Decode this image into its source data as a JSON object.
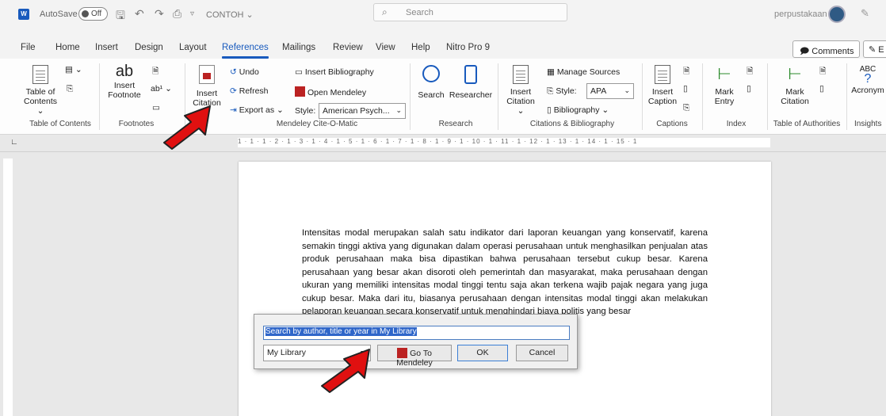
{
  "titlebar": {
    "autosave_label": "AutoSave",
    "autosave_state": "Off",
    "document_name": "CONTOH",
    "search_placeholder": "Search",
    "user_name": "perpustakaan"
  },
  "tabs": [
    "File",
    "Home",
    "Insert",
    "Design",
    "Layout",
    "References",
    "Mailings",
    "Review",
    "View",
    "Help",
    "Nitro Pro 9"
  ],
  "active_tab": "References",
  "header_buttons": {
    "comments": "Comments",
    "editing": "E"
  },
  "ribbon": {
    "toc": {
      "label1": "Table of",
      "label2": "Contents",
      "group": "Table of Contents"
    },
    "footnotes": {
      "ab": "ab",
      "insert1": "Insert",
      "insert2": "Footnote",
      "group": "Footnotes"
    },
    "insert_citation": {
      "line1": "Insert",
      "line2": "Citation"
    },
    "mendeley": {
      "undo": "Undo",
      "refresh": "Refresh",
      "export": "Export as",
      "insert_bibliography": "Insert Bibliography",
      "open_mendeley": "Open Mendeley",
      "style_label": "Style:",
      "style_value": "American Psych...",
      "group": "Mendeley Cite-O-Matic"
    },
    "research": {
      "search": "Search",
      "researcher": "Researcher",
      "group": "Research"
    },
    "citations": {
      "insert1": "Insert",
      "insert2": "Citation",
      "manage_sources": "Manage Sources",
      "style_label": "Style:",
      "style_value": "APA",
      "bibliography": "Bibliography",
      "group": "Citations & Bibliography"
    },
    "captions": {
      "insert1": "Insert",
      "insert2": "Caption",
      "group": "Captions"
    },
    "index": {
      "mark1": "Mark",
      "mark2": "Entry",
      "group": "Index"
    },
    "authorities": {
      "mark1": "Mark",
      "mark2": "Citation",
      "group": "Table of Authorities"
    },
    "insights": {
      "abc": "ABC",
      "q": "?",
      "acronyms": "Acronym",
      "group": "Insights"
    }
  },
  "ruler_text": "1 · 1 · 1 · 2 · 1 · 3 · 1 · 4 · 1 · 5 · 1 · 6 · 1 · 7 · 1 · 8 · 1 · 9 · 1 · 10 · 1 · 11 · 1 · 12 · 1 · 13 · 1 · 14 · 1 · 15 · 1",
  "document": {
    "paragraph": "Intensitas modal merupakan salah satu indikator dari laporan keuangan yang konservatif, karena semakin tinggi aktiva yang digunakan dalam operasi perusahaan untuk menghasilkan penjualan atas produk perusahaan maka bisa dipastikan bahwa perusahaan tersebut cukup besar. Karena perusahaan yang besar akan disoroti oleh pemerintah dan masyarakat, maka perusahaan dengan ukuran yang memiliki intensitas modal tinggi tentu saja akan terkena wajib pajak negara yang juga cukup besar. Maka dari itu, biasanya perusahaan dengan intensitas modal tinggi akan melakukan pelaporan keuangan secara konservatif untuk menghindari biaya politis yang besar"
  },
  "dialog": {
    "search_value": "Search by author, title or year in My Library",
    "library_value": "My Library",
    "go_to_mendeley": "Go To Mendeley",
    "ok": "OK",
    "cancel": "Cancel"
  }
}
